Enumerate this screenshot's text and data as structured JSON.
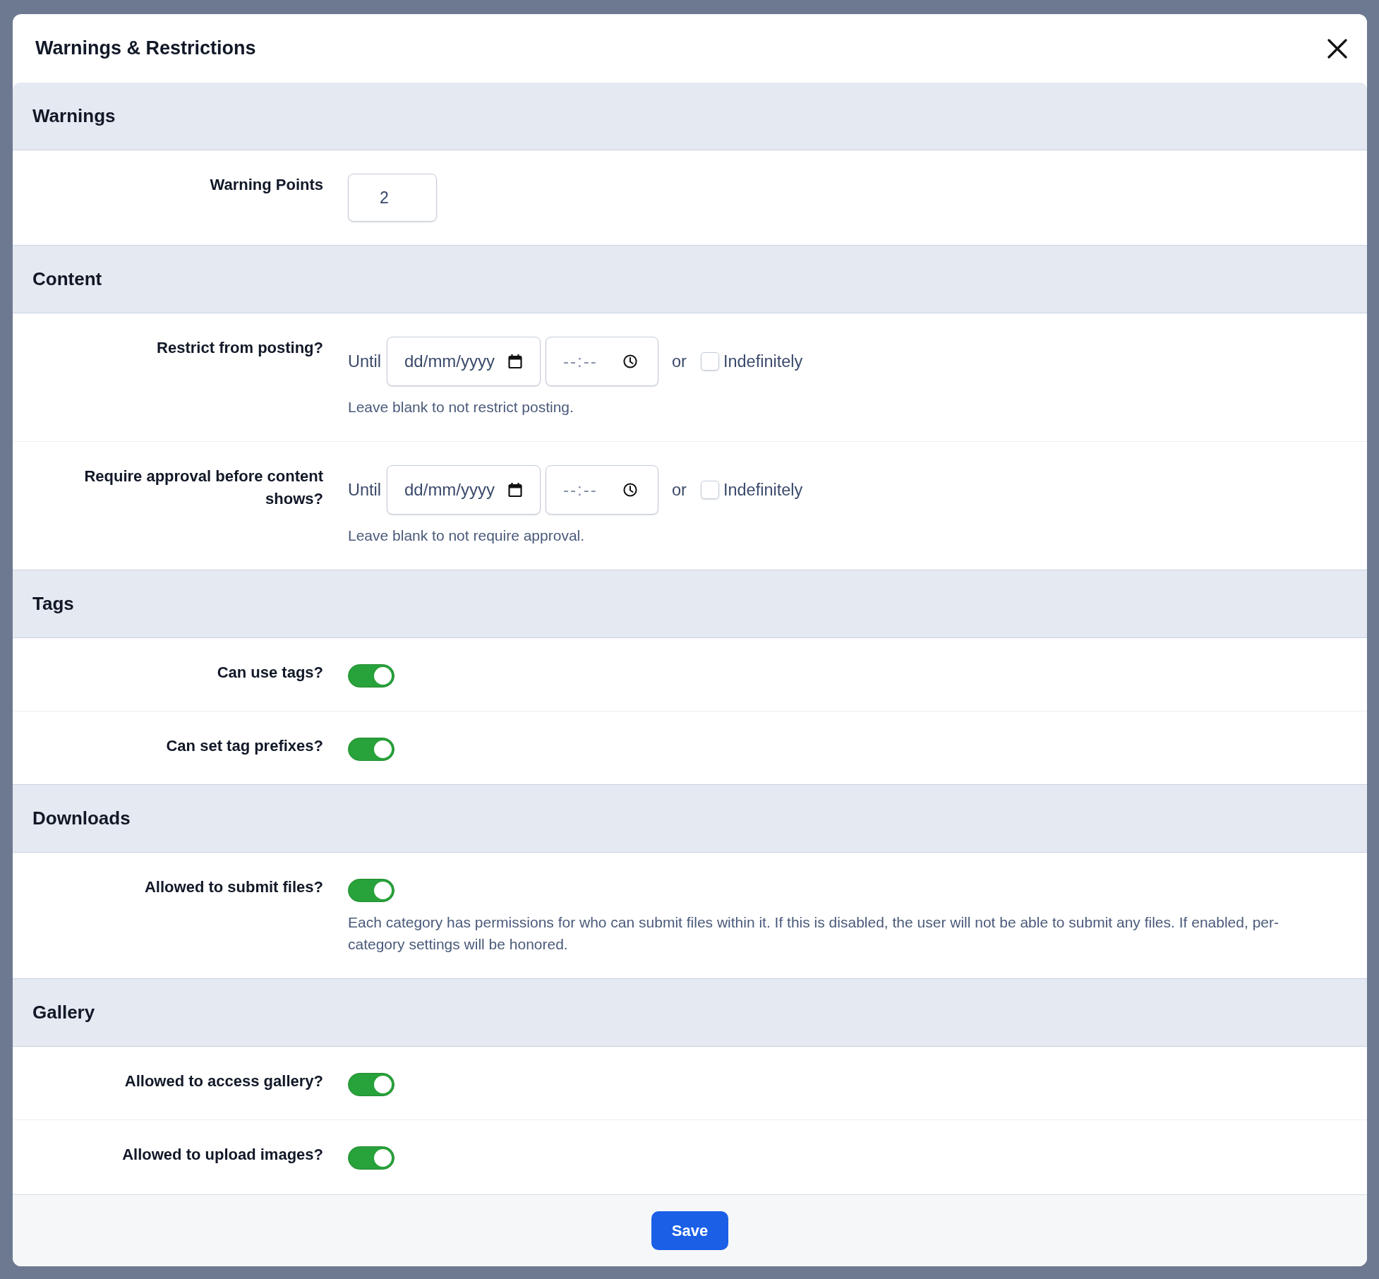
{
  "dialog": {
    "title": "Warnings & Restrictions"
  },
  "sections": [
    {
      "title": "Warnings",
      "fields": [
        {
          "kind": "number",
          "label": "Warning Points",
          "value": "2"
        }
      ]
    },
    {
      "title": "Content",
      "fields": [
        {
          "kind": "until",
          "label": "Restrict from posting?",
          "prefix": "Until",
          "date": {
            "placeholder": "dd/mm/yyyy"
          },
          "time": {
            "placeholder": "--:--"
          },
          "conjunction": "or",
          "checkbox": {
            "label": "Indefinitely",
            "checked": false
          },
          "help": "Leave blank to not restrict posting."
        },
        {
          "kind": "until",
          "label": "Require approval before content shows?",
          "prefix": "Until",
          "date": {
            "placeholder": "dd/mm/yyyy"
          },
          "time": {
            "placeholder": "--:--"
          },
          "conjunction": "or",
          "checkbox": {
            "label": "Indefinitely",
            "checked": false
          },
          "help": "Leave blank to not require approval."
        }
      ]
    },
    {
      "title": "Tags",
      "fields": [
        {
          "kind": "toggle",
          "label": "Can use tags?",
          "on": true
        },
        {
          "kind": "toggle",
          "label": "Can set tag prefixes?",
          "on": true
        }
      ]
    },
    {
      "title": "Downloads",
      "fields": [
        {
          "kind": "toggle",
          "label": "Allowed to submit files?",
          "on": true,
          "help": "Each category has permissions for who can submit files within it. If this is disabled, the user will not be able to submit any files. If enabled, per-category settings will be honored."
        }
      ]
    },
    {
      "title": "Gallery",
      "fields": [
        {
          "kind": "toggle",
          "label": "Allowed to access gallery?",
          "on": true
        },
        {
          "kind": "toggle",
          "label": "Allowed to upload images?",
          "on": true
        }
      ]
    }
  ],
  "footer": {
    "save_button": "Save"
  }
}
